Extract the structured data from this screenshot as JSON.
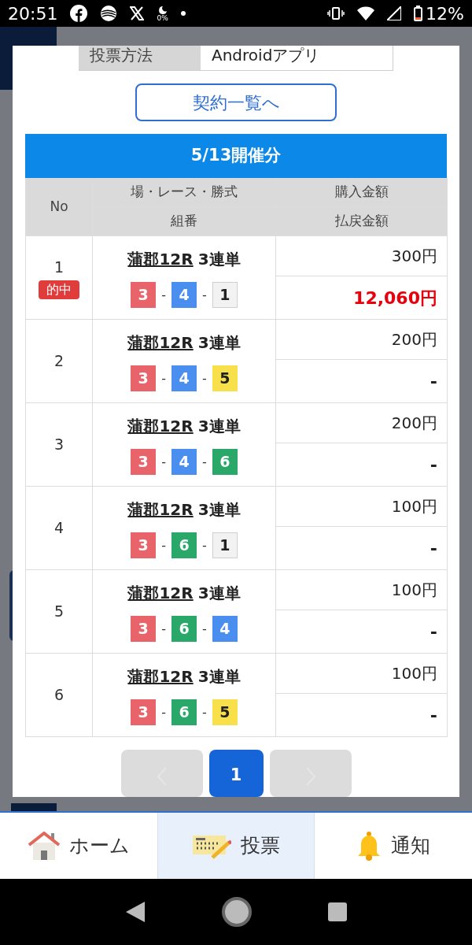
{
  "status_bar": {
    "time": "20:51",
    "notification_badge": "0%",
    "battery": "12%"
  },
  "info": {
    "label": "投票方法",
    "value": "Androidアプリ"
  },
  "contract_button": "契約一覧へ",
  "table": {
    "title": "5/13開催分",
    "columns": {
      "no": "No",
      "race": "場・レース・勝式",
      "combo": "組番",
      "amount": "購入金額",
      "payout": "払戻金額"
    },
    "rows": [
      {
        "no": "1",
        "hit": true,
        "hit_label": "的中",
        "venue": "蒲郡12R",
        "bet_type": "3連単",
        "balls": [
          {
            "number": "3",
            "color": "#e8636a"
          },
          {
            "number": "4",
            "color": "#4a8ef0"
          },
          {
            "number": "1",
            "color": "#f2f2f2"
          }
        ],
        "amount": "300円",
        "payout": "12,060円"
      },
      {
        "no": "2",
        "hit": false,
        "venue": "蒲郡12R",
        "bet_type": "3連単",
        "balls": [
          {
            "number": "3",
            "color": "#e8636a"
          },
          {
            "number": "4",
            "color": "#4a8ef0"
          },
          {
            "number": "5",
            "color": "#f7e04a"
          }
        ],
        "amount": "200円",
        "payout": "-"
      },
      {
        "no": "3",
        "hit": false,
        "venue": "蒲郡12R",
        "bet_type": "3連単",
        "balls": [
          {
            "number": "3",
            "color": "#e8636a"
          },
          {
            "number": "4",
            "color": "#4a8ef0"
          },
          {
            "number": "6",
            "color": "#2aa86a"
          }
        ],
        "amount": "200円",
        "payout": "-"
      },
      {
        "no": "4",
        "hit": false,
        "venue": "蒲郡12R",
        "bet_type": "3連単",
        "balls": [
          {
            "number": "3",
            "color": "#e8636a"
          },
          {
            "number": "6",
            "color": "#2aa86a"
          },
          {
            "number": "1",
            "color": "#f2f2f2"
          }
        ],
        "amount": "100円",
        "payout": "-"
      },
      {
        "no": "5",
        "hit": false,
        "venue": "蒲郡12R",
        "bet_type": "3連単",
        "balls": [
          {
            "number": "3",
            "color": "#e8636a"
          },
          {
            "number": "6",
            "color": "#2aa86a"
          },
          {
            "number": "4",
            "color": "#4a8ef0"
          }
        ],
        "amount": "100円",
        "payout": "-"
      },
      {
        "no": "6",
        "hit": false,
        "venue": "蒲郡12R",
        "bet_type": "3連単",
        "balls": [
          {
            "number": "3",
            "color": "#e8636a"
          },
          {
            "number": "6",
            "color": "#2aa86a"
          },
          {
            "number": "5",
            "color": "#f7e04a"
          }
        ],
        "amount": "100円",
        "payout": "-"
      }
    ],
    "separator": "-"
  },
  "pagination": {
    "pages": [
      {
        "label": "1",
        "selected": true
      }
    ]
  },
  "bottom_nav": [
    {
      "kind": "home",
      "label": "ホーム",
      "selected": false
    },
    {
      "kind": "vote",
      "label": "投票",
      "selected": true
    },
    {
      "kind": "bell",
      "label": "通知",
      "selected": false
    }
  ]
}
